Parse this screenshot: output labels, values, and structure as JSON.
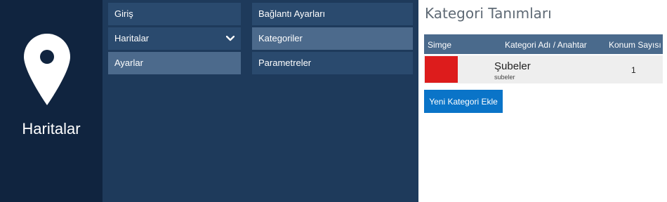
{
  "brand": {
    "title": "Haritalar",
    "icon": "map-pin-icon"
  },
  "nav_primary": {
    "items": [
      {
        "label": "Giriş"
      },
      {
        "label": "Haritalar",
        "icon": "chevron-down-icon"
      },
      {
        "label": "Ayarlar",
        "active": true
      }
    ]
  },
  "nav_secondary": {
    "items": [
      {
        "label": "Bağlantı Ayarları"
      },
      {
        "label": "Kategoriler",
        "active": true
      },
      {
        "label": "Parametreler"
      }
    ]
  },
  "main": {
    "title": "Kategori Tanımları",
    "table": {
      "columns": [
        "Simge",
        "Kategori Adı / Anahtar",
        "Konum Sayısı"
      ],
      "rows": [
        {
          "color": "#dd1c1c",
          "name": "Şubeler",
          "key": "subeler",
          "count": "1"
        }
      ]
    },
    "add_button_label": "Yeni Kategori Ekle"
  },
  "colors": {
    "brand_bg": "#10243f",
    "nav_bg": "#1e3a5b",
    "nav_item": "#2a4a6e",
    "nav_active": "#4c6a8c",
    "header_bg": "#4a6a8c",
    "button": "#0a74c8"
  }
}
